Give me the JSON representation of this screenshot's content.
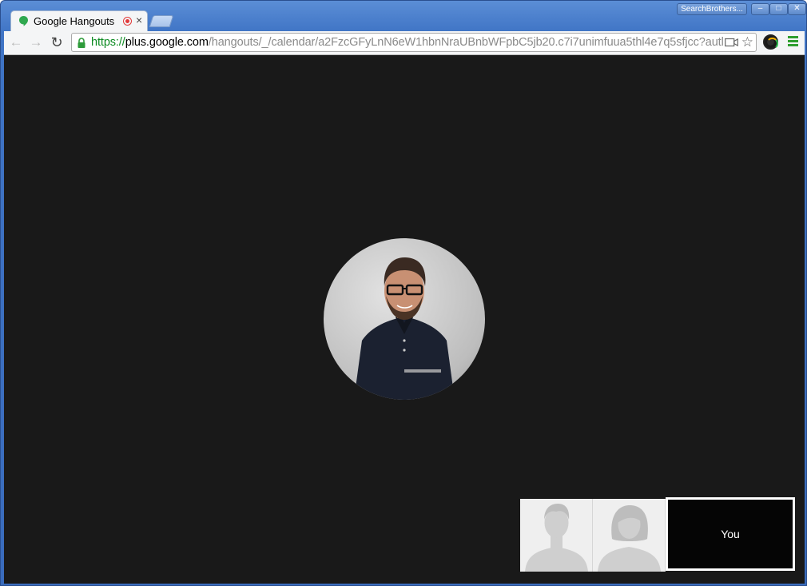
{
  "window": {
    "tab_title": "Google Hangouts",
    "profile_name": "SearchBrothers...",
    "controls": {
      "minimize": "–",
      "maximize": "□",
      "close": "✕"
    }
  },
  "toolbar": {
    "icons": {
      "back": "arrow-left",
      "forward": "arrow-right",
      "reload": "reload",
      "bookmark": "star",
      "menu": "hamburger"
    },
    "url": {
      "scheme": "https://",
      "host": "plus.google.com",
      "path": "/hangouts/_/calendar/a2FzcGFyLnN6eW1hbnNraUBnbWFpbC5jb20.c7i7unimfuua5thl4e7q5sfjcc?autl"
    }
  },
  "call": {
    "main_participant": "presenter-avatar",
    "filmstrip": [
      {
        "type": "male-placeholder"
      },
      {
        "type": "female-placeholder"
      }
    ],
    "self_label": "You"
  },
  "colors": {
    "stage_bg": "#191919",
    "self_view_bg": "#050505",
    "secure_scheme": "#0a8a1f",
    "chrome_frame": "#3f74c5"
  }
}
